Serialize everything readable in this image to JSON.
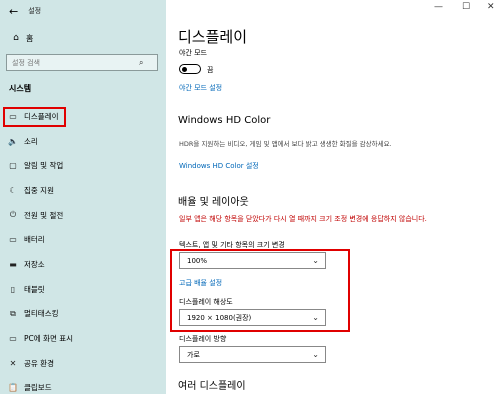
{
  "window": {
    "app_title": "설정",
    "minimize": "—",
    "maximize": "☐",
    "close": "✕"
  },
  "sidebar": {
    "back": "←",
    "home_label": "홈",
    "search_placeholder": "설정 검색",
    "section": "시스템",
    "items": [
      {
        "icon": "monitor-icon",
        "glyph": "▭",
        "label": "디스플레이"
      },
      {
        "icon": "speaker-icon",
        "glyph": "🔈",
        "label": "소리"
      },
      {
        "icon": "notification-icon",
        "glyph": "▢",
        "label": "알림 및 작업"
      },
      {
        "icon": "moon-icon",
        "glyph": "☾",
        "label": "집중 지원"
      },
      {
        "icon": "power-icon",
        "glyph": "⏻",
        "label": "전원 및 절전"
      },
      {
        "icon": "battery-icon",
        "glyph": "▭",
        "label": "배터리"
      },
      {
        "icon": "storage-icon",
        "glyph": "▬",
        "label": "저장소"
      },
      {
        "icon": "tablet-icon",
        "glyph": "▯",
        "label": "태블릿"
      },
      {
        "icon": "multitask-icon",
        "glyph": "⧉",
        "label": "멀티태스킹"
      },
      {
        "icon": "project-icon",
        "glyph": "▭",
        "label": "PC에 화면 표시"
      },
      {
        "icon": "share-icon",
        "glyph": "✕",
        "label": "공유 환경"
      },
      {
        "icon": "clipboard-icon",
        "glyph": "📋",
        "label": "클립보드"
      }
    ]
  },
  "main": {
    "title": "디스플레이",
    "night_light_label": "야간 모드",
    "night_light_state": "끔",
    "night_light_link": "야간 모드 설정",
    "hd_title": "Windows HD Color",
    "hd_desc": "HDR을 지원하는 비디오, 게임 및 앱에서 보다 밝고 생생한 화질을 감상하세요.",
    "hd_link": "Windows HD Color 설정",
    "layout_title": "배율 및 레이아웃",
    "warning": "일부 앱은 해당 항목을 닫았다가 다시 열 때까지 크기 조정 변경에 응답하지 않습니다.",
    "scale_label": "텍스트, 앱 및 기타 항목의 크기 변경",
    "scale_value": "100%",
    "advanced_link": "고급 배율 설정",
    "resolution_label": "디스플레이 해상도",
    "resolution_value": "1920 × 1080(권장)",
    "orientation_label": "디스플레이 방향",
    "orientation_value": "가로",
    "multi_title": "여러 디스플레이"
  },
  "highlight_color": "#e00000",
  "accent_color": "#0067b8",
  "sidebar_bg": "#d0e6e6"
}
